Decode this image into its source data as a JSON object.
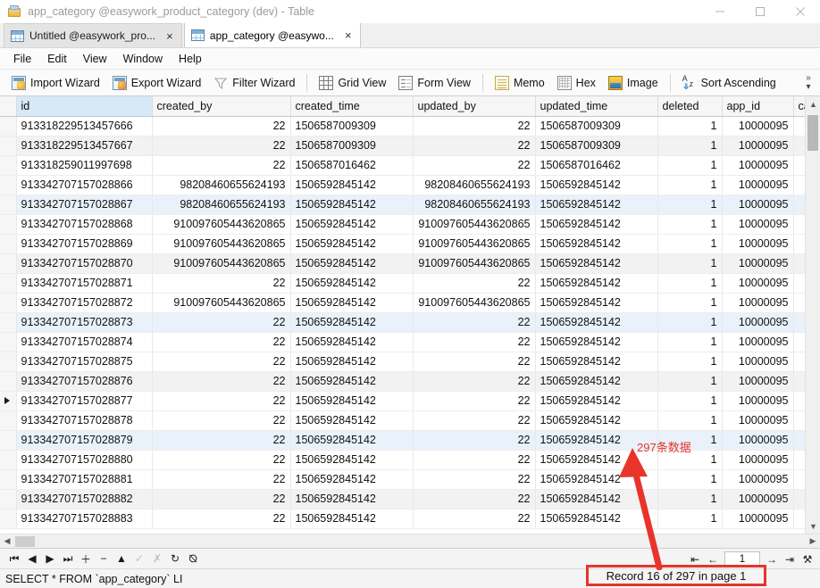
{
  "window": {
    "title": "app_category @easywork_product_category (dev) - Table",
    "icon": "table-window-icon",
    "controls": {
      "minimize": "minimize-icon",
      "maximize": "maximize-icon",
      "close": "close-icon"
    }
  },
  "tabs": [
    {
      "label": "Untitled @easywork_pro...",
      "active": false,
      "close": "×"
    },
    {
      "label": "app_category @easywo...",
      "active": true,
      "close": "×"
    }
  ],
  "menubar": {
    "items": [
      "File",
      "Edit",
      "View",
      "Window",
      "Help"
    ]
  },
  "toolbar": {
    "groups": [
      {
        "items": [
          {
            "label": "Import Wizard",
            "icon": "import-wizard-icon"
          },
          {
            "label": "Export Wizard",
            "icon": "export-wizard-icon"
          },
          {
            "label": "Filter Wizard",
            "icon": "filter-wizard-icon"
          }
        ]
      },
      {
        "items": [
          {
            "label": "Grid View",
            "icon": "grid-view-icon"
          },
          {
            "label": "Form View",
            "icon": "form-view-icon"
          }
        ]
      },
      {
        "items": [
          {
            "label": "Memo",
            "icon": "memo-icon"
          },
          {
            "label": "Hex",
            "icon": "hex-icon"
          },
          {
            "label": "Image",
            "icon": "image-icon"
          }
        ]
      },
      {
        "items": [
          {
            "label": "Sort Ascending",
            "icon": "sort-ascending-icon"
          }
        ]
      }
    ],
    "overflow": "»",
    "overflow_arrow": "▾"
  },
  "grid": {
    "columns": [
      {
        "key": "id",
        "label": "id",
        "selected": true,
        "align": "left"
      },
      {
        "key": "created_by",
        "label": "created_by",
        "selected": false,
        "align": "right"
      },
      {
        "key": "created_time",
        "label": "created_time",
        "selected": false,
        "align": "left"
      },
      {
        "key": "updated_by",
        "label": "updated_by",
        "selected": false,
        "align": "right"
      },
      {
        "key": "updated_time",
        "label": "updated_time",
        "selected": false,
        "align": "left"
      },
      {
        "key": "deleted",
        "label": "deleted",
        "selected": false,
        "align": "right"
      },
      {
        "key": "app_id",
        "label": "app_id",
        "selected": false,
        "align": "right"
      },
      {
        "key": "cat",
        "label": "cat",
        "selected": false,
        "align": "left"
      }
    ],
    "current_row_index": 16,
    "rows": [
      {
        "id": "913318229513457666",
        "created_by": "22",
        "created_time": "1506587009309",
        "updated_by": "22",
        "updated_time": "1506587009309",
        "deleted": "1",
        "app_id": "10000095",
        "cat": ""
      },
      {
        "id": "913318229513457667",
        "created_by": "22",
        "created_time": "1506587009309",
        "updated_by": "22",
        "updated_time": "1506587009309",
        "deleted": "1",
        "app_id": "10000095",
        "cat": ""
      },
      {
        "id": "913318259011997698",
        "created_by": "22",
        "created_time": "1506587016462",
        "updated_by": "22",
        "updated_time": "1506587016462",
        "deleted": "1",
        "app_id": "10000095",
        "cat": ""
      },
      {
        "id": "913342707157028866",
        "created_by": "98208460655624193",
        "created_time": "1506592845142",
        "updated_by": "98208460655624193",
        "updated_time": "1506592845142",
        "deleted": "1",
        "app_id": "10000095",
        "cat": ""
      },
      {
        "id": "913342707157028867",
        "created_by": "98208460655624193",
        "created_time": "1506592845142",
        "updated_by": "98208460655624193",
        "updated_time": "1506592845142",
        "deleted": "1",
        "app_id": "10000095",
        "cat": ""
      },
      {
        "id": "913342707157028868",
        "created_by": "910097605443620865",
        "created_time": "1506592845142",
        "updated_by": "910097605443620865",
        "updated_time": "1506592845142",
        "deleted": "1",
        "app_id": "10000095",
        "cat": ""
      },
      {
        "id": "913342707157028869",
        "created_by": "910097605443620865",
        "created_time": "1506592845142",
        "updated_by": "910097605443620865",
        "updated_time": "1506592845142",
        "deleted": "1",
        "app_id": "10000095",
        "cat": ""
      },
      {
        "id": "913342707157028870",
        "created_by": "910097605443620865",
        "created_time": "1506592845142",
        "updated_by": "910097605443620865",
        "updated_time": "1506592845142",
        "deleted": "1",
        "app_id": "10000095",
        "cat": ""
      },
      {
        "id": "913342707157028871",
        "created_by": "22",
        "created_time": "1506592845142",
        "updated_by": "22",
        "updated_time": "1506592845142",
        "deleted": "1",
        "app_id": "10000095",
        "cat": ""
      },
      {
        "id": "913342707157028872",
        "created_by": "910097605443620865",
        "created_time": "1506592845142",
        "updated_by": "910097605443620865",
        "updated_time": "1506592845142",
        "deleted": "1",
        "app_id": "10000095",
        "cat": ""
      },
      {
        "id": "913342707157028873",
        "created_by": "22",
        "created_time": "1506592845142",
        "updated_by": "22",
        "updated_time": "1506592845142",
        "deleted": "1",
        "app_id": "10000095",
        "cat": ""
      },
      {
        "id": "913342707157028874",
        "created_by": "22",
        "created_time": "1506592845142",
        "updated_by": "22",
        "updated_time": "1506592845142",
        "deleted": "1",
        "app_id": "10000095",
        "cat": ""
      },
      {
        "id": "913342707157028875",
        "created_by": "22",
        "created_time": "1506592845142",
        "updated_by": "22",
        "updated_time": "1506592845142",
        "deleted": "1",
        "app_id": "10000095",
        "cat": ""
      },
      {
        "id": "913342707157028876",
        "created_by": "22",
        "created_time": "1506592845142",
        "updated_by": "22",
        "updated_time": "1506592845142",
        "deleted": "1",
        "app_id": "10000095",
        "cat": ""
      },
      {
        "id": "913342707157028877",
        "created_by": "22",
        "created_time": "1506592845142",
        "updated_by": "22",
        "updated_time": "1506592845142",
        "deleted": "1",
        "app_id": "10000095",
        "cat": ""
      },
      {
        "id": "913342707157028878",
        "created_by": "22",
        "created_time": "1506592845142",
        "updated_by": "22",
        "updated_time": "1506592845142",
        "deleted": "1",
        "app_id": "10000095",
        "cat": ""
      },
      {
        "id": "913342707157028879",
        "created_by": "22",
        "created_time": "1506592845142",
        "updated_by": "22",
        "updated_time": "1506592845142",
        "deleted": "1",
        "app_id": "10000095",
        "cat": ""
      },
      {
        "id": "913342707157028880",
        "created_by": "22",
        "created_time": "1506592845142",
        "updated_by": "22",
        "updated_time": "1506592845142",
        "deleted": "1",
        "app_id": "10000095",
        "cat": ""
      },
      {
        "id": "913342707157028881",
        "created_by": "22",
        "created_time": "1506592845142",
        "updated_by": "22",
        "updated_time": "1506592845142",
        "deleted": "1",
        "app_id": "10000095",
        "cat": ""
      },
      {
        "id": "913342707157028882",
        "created_by": "22",
        "created_time": "1506592845142",
        "updated_by": "22",
        "updated_time": "1506592845142",
        "deleted": "1",
        "app_id": "10000095",
        "cat": ""
      },
      {
        "id": "913342707157028883",
        "created_by": "22",
        "created_time": "1506592845142",
        "updated_by": "22",
        "updated_time": "1506592845142",
        "deleted": "1",
        "app_id": "10000095",
        "cat": ""
      }
    ]
  },
  "navbar": {
    "buttons": [
      {
        "name": "first-record",
        "glyph": "⏮",
        "enabled": true
      },
      {
        "name": "previous-record",
        "glyph": "◀",
        "enabled": true
      },
      {
        "name": "next-record",
        "glyph": "▶",
        "enabled": true
      },
      {
        "name": "last-record",
        "glyph": "⏭",
        "enabled": true
      },
      {
        "name": "add-record",
        "glyph": "＋",
        "enabled": true
      },
      {
        "name": "delete-record",
        "glyph": "−",
        "enabled": true
      },
      {
        "name": "apply-change",
        "glyph": "▲",
        "enabled": true
      },
      {
        "name": "confirm-edit",
        "glyph": "✓",
        "enabled": false
      },
      {
        "name": "cancel-edit",
        "glyph": "✗",
        "enabled": false
      },
      {
        "name": "refresh",
        "glyph": "↻",
        "enabled": true
      },
      {
        "name": "stop",
        "glyph": "⦰",
        "enabled": true
      }
    ],
    "page_value": "1",
    "page_nav": [
      {
        "name": "first-page",
        "glyph": "⇤"
      },
      {
        "name": "previous-page",
        "glyph": "←"
      },
      {
        "name": "next-page",
        "glyph": "→"
      },
      {
        "name": "last-page",
        "glyph": "⇥"
      },
      {
        "name": "customize-tools",
        "glyph": "⚒"
      }
    ]
  },
  "statusbar": {
    "sql": "SELECT * FROM `app_category` LI"
  },
  "annotations": {
    "note_text": "297条数据",
    "record_status": "Record 16 of 297 in page 1",
    "color": "#e8342a"
  }
}
